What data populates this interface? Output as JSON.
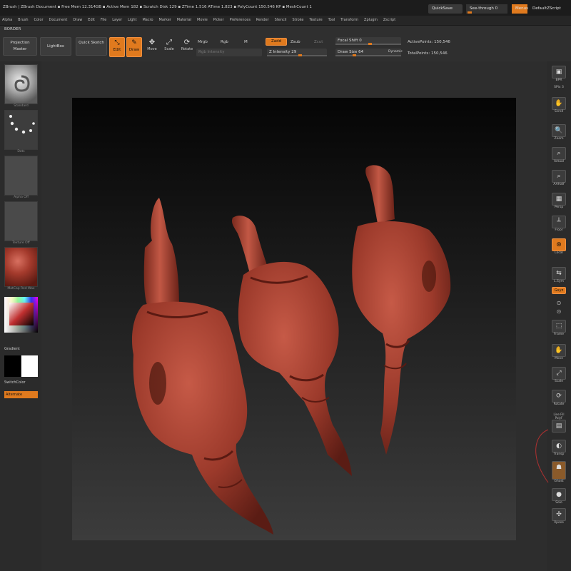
{
  "titlebar": {
    "title": "ZBrush  |  ZBrush Document   ▪ Free Mem 12.314GB ▪ Active Mem 182 ▪ Scratch Disk 129 ▪ ZTime 1.516 ATime 1.823 ▪ PolyCount 150.546 KP ▪ MeshCount 1",
    "quicksave": "QuickSave",
    "see_through": "See-through  0",
    "menus": "Menus",
    "default_script": "DefaultZScript"
  },
  "menubar": [
    "Alpha",
    "Brush",
    "Color",
    "Document",
    "Draw",
    "Edit",
    "File",
    "Layer",
    "Light",
    "Macro",
    "Marker",
    "Material",
    "Movie",
    "Picker",
    "Preferences",
    "Render",
    "Stencil",
    "Stroke",
    "Texture",
    "Tool",
    "Transform",
    "Zplugin",
    "Zscript"
  ],
  "toolbar": {
    "section_label": "BORDER",
    "projection_master": "Projection Master",
    "lightbox": "LightBox",
    "quick_sketch": "Quick Sketch",
    "edit": "Edit",
    "draw": "Draw",
    "move": "Move",
    "scale": "Scale",
    "rotate": "Rotate",
    "mrgb": "Mrgb",
    "rgb": "Rgb",
    "m": "M",
    "rgb_intensity": "Rgb Intensity",
    "zadd": "Zadd",
    "zsub": "Zsub",
    "zcut": "Zcut",
    "z_intensity": "Z Intensity 29",
    "focal_shift": "Focal Shift 0",
    "draw_size": "Draw Size 64",
    "dynamic": "Dynamic",
    "active_points": "ActivePoints: 150,546",
    "total_points": "TotalPoints: 150,546"
  },
  "leftshelf": {
    "material_label": "Standard",
    "stroke_label": "Dots",
    "alpha_label": "Alpha Off",
    "texture_label": "Texture Off",
    "matcap_label": "MatCap Red Wax",
    "gradient": "Gradient",
    "switch_color": "SwitchColor",
    "alternate": "Alternate"
  },
  "rightshelf": [
    "BPR",
    "SPix 3",
    "Scroll",
    "Zoom",
    "Actual",
    "AAHalf",
    "Persp",
    "Floor",
    "Local",
    "L.Sym",
    "Gxyz",
    "",
    "",
    "Frame",
    "Move",
    "Scale",
    "Rotate",
    "Line Fill PolyF",
    "Transp",
    "Ghost",
    "Solo",
    "Xpose"
  ],
  "colors": {
    "accent": "#e07a1e",
    "clay": "#a63f30"
  }
}
